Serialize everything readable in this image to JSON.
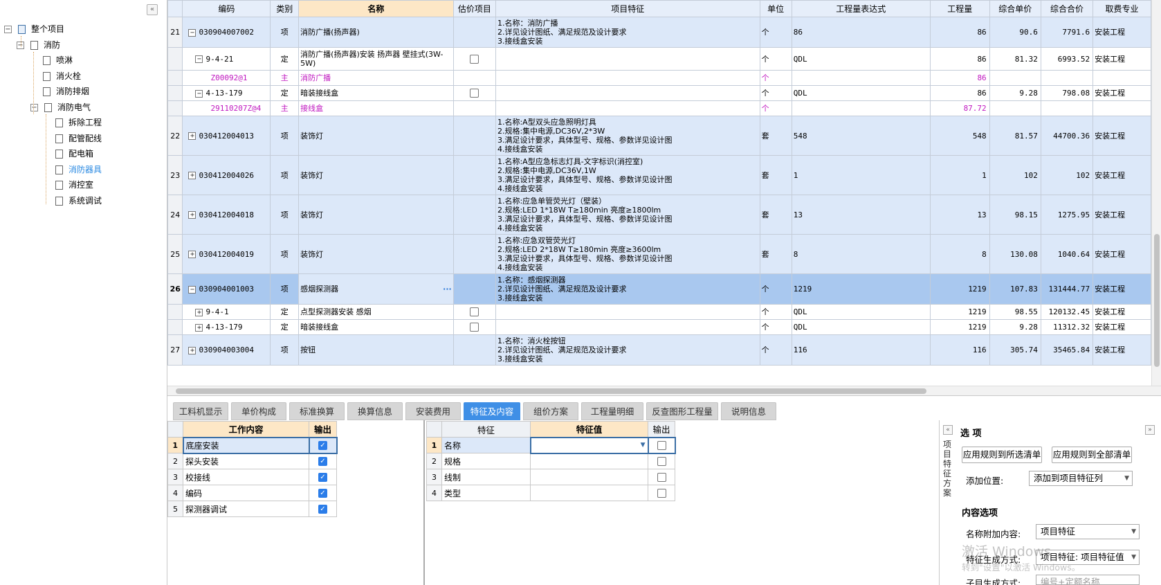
{
  "tree": {
    "collapse_icon": "«",
    "items": [
      {
        "label": "整个项目",
        "level": 0,
        "expander": "−",
        "root": true
      },
      {
        "label": "消防",
        "level": 1,
        "expander": "−"
      },
      {
        "label": "喷淋",
        "level": 2
      },
      {
        "label": "消火栓",
        "level": 2
      },
      {
        "label": "消防排烟",
        "level": 2
      },
      {
        "label": "消防电气",
        "level": 2,
        "expander": "−"
      },
      {
        "label": "拆除工程",
        "level": 3
      },
      {
        "label": "配管配线",
        "level": 3
      },
      {
        "label": "配电箱",
        "level": 3
      },
      {
        "label": "消防器具",
        "level": 3,
        "selected": true
      },
      {
        "label": "消控室",
        "level": 3
      },
      {
        "label": "系统调试",
        "level": 3
      }
    ]
  },
  "grid": {
    "headers": [
      "",
      "编码",
      "类别",
      "名称",
      "估价项目",
      "项目特征",
      "单位",
      "工程量表达式",
      "工程量",
      "综合单价",
      "综合合价",
      "取费专业"
    ],
    "rows": [
      {
        "type": "item",
        "no": "21",
        "exp": "−",
        "code": "030904007002",
        "cat": "项",
        "name": "消防广播(扬声器)",
        "est": "",
        "feat": "1.名称：消防广播\n2.详见设计图纸、满足规范及设计要求\n3.接线盒安装",
        "unit": "个",
        "expr": "86",
        "qty": "86",
        "price": "90.6",
        "total": "7791.6",
        "prof": "安装工程",
        "h": 44
      },
      {
        "type": "ding",
        "no": "",
        "exp": "−",
        "code": "9-4-21",
        "cat": "定",
        "name": "消防广播(扬声器)安装 扬声器 壁挂式(3W-5W)",
        "est": "cb",
        "feat": "",
        "unit": "个",
        "expr": "QDL",
        "qty": "86",
        "price": "81.32",
        "total": "6993.52",
        "prof": "安装工程",
        "h": 33
      },
      {
        "type": "zhu",
        "no": "",
        "exp": "",
        "code": "Z00092@1",
        "cat": "主",
        "name": "消防广播",
        "est": "",
        "feat": "",
        "unit": "个",
        "expr": "",
        "qty": "86",
        "price": "",
        "total": "",
        "prof": "",
        "h": 22
      },
      {
        "type": "ding",
        "no": "",
        "exp": "−",
        "code": "4-13-179",
        "cat": "定",
        "name": "暗装接线盒",
        "est": "cb",
        "feat": "",
        "unit": "个",
        "expr": "QDL",
        "qty": "86",
        "price": "9.28",
        "total": "798.08",
        "prof": "安装工程",
        "h": 22
      },
      {
        "type": "zhu",
        "no": "",
        "exp": "",
        "code": "29110207Z@4",
        "cat": "主",
        "name": "接线盒",
        "est": "",
        "feat": "",
        "unit": "个",
        "expr": "",
        "qty": "87.72",
        "price": "",
        "total": "",
        "prof": "",
        "h": 22
      },
      {
        "type": "item",
        "no": "22",
        "exp": "+",
        "code": "030412004013",
        "cat": "项",
        "name": "装饰灯",
        "est": "",
        "feat": "1.名称:A型双头应急照明灯具\n2.规格:集中电源,DC36V,2*3W\n3.满足设计要求，具体型号、规格、参数详见设计图\n4.接线盒安装",
        "unit": "套",
        "expr": "548",
        "qty": "548",
        "price": "81.57",
        "total": "44700.36",
        "prof": "安装工程",
        "h": 57
      },
      {
        "type": "item",
        "no": "23",
        "exp": "+",
        "code": "030412004026",
        "cat": "项",
        "name": "装饰灯",
        "est": "",
        "feat": "1.名称:A型应急标志灯具-文字标识(消控室)\n2.规格:集中电源,DC36V,1W\n3.满足设计要求，具体型号、规格、参数详见设计图\n4.接线盒安装",
        "unit": "套",
        "expr": "1",
        "qty": "1",
        "price": "102",
        "total": "102",
        "prof": "安装工程",
        "h": 57
      },
      {
        "type": "item",
        "no": "24",
        "exp": "+",
        "code": "030412004018",
        "cat": "项",
        "name": "装饰灯",
        "est": "",
        "feat": "1.名称:应急单管荧光灯（壁装）\n2.规格:LED 1*18W T≥180min 亮度≥1800lm\n3.满足设计要求，具体型号、规格、参数详见设计图\n4.接线盒安装",
        "unit": "套",
        "expr": "13",
        "qty": "13",
        "price": "98.15",
        "total": "1275.95",
        "prof": "安装工程",
        "h": 57
      },
      {
        "type": "item",
        "no": "25",
        "exp": "+",
        "code": "030412004019",
        "cat": "项",
        "name": "装饰灯",
        "est": "",
        "feat": "1.名称:应急双管荧光灯\n2.规格:LED 2*18W T≥180min 亮度≥3600lm\n3.满足设计要求，具体型号、规格、参数详见设计图\n4.接线盒安装",
        "unit": "套",
        "expr": "8",
        "qty": "8",
        "price": "130.08",
        "total": "1040.64",
        "prof": "安装工程",
        "h": 57
      },
      {
        "type": "sel",
        "no": "26",
        "exp": "−",
        "code": "030904001003",
        "cat": "项",
        "name": "感烟探测器",
        "est": "",
        "feat": "1.名称：感烟探测器\n2.详见设计图纸、满足规范及设计要求\n3.接线盒安装",
        "unit": "个",
        "expr": "1219",
        "qty": "1219",
        "price": "107.83",
        "total": "131444.77",
        "prof": "安装工程",
        "h": 44
      },
      {
        "type": "ding",
        "no": "",
        "exp": "+",
        "code": "9-4-1",
        "cat": "定",
        "name": "点型探测器安装 感烟",
        "est": "cb",
        "feat": "",
        "unit": "个",
        "expr": "QDL",
        "qty": "1219",
        "price": "98.55",
        "total": "120132.45",
        "prof": "安装工程",
        "h": 22
      },
      {
        "type": "ding",
        "no": "",
        "exp": "+",
        "code": "4-13-179",
        "cat": "定",
        "name": "暗装接线盒",
        "est": "cb",
        "feat": "",
        "unit": "个",
        "expr": "QDL",
        "qty": "1219",
        "price": "9.28",
        "total": "11312.32",
        "prof": "安装工程",
        "h": 22
      },
      {
        "type": "item",
        "no": "27",
        "exp": "+",
        "code": "030904003004",
        "cat": "项",
        "name": "按钮",
        "est": "",
        "feat": "1.名称：消火栓按钮\n2.详见设计图纸、满足规范及设计要求\n3.接线盒安装",
        "unit": "个",
        "expr": "116",
        "qty": "116",
        "price": "305.74",
        "total": "35465.84",
        "prof": "安装工程",
        "h": 44
      }
    ],
    "ellipsis": "···"
  },
  "tabs": [
    "工料机显示",
    "单价构成",
    "标准换算",
    "换算信息",
    "安装费用",
    "特征及内容",
    "组价方案",
    "工程量明细",
    "反查图形工程量",
    "说明信息"
  ],
  "active_tab": "特征及内容",
  "work_content": {
    "headers": [
      "",
      "工作内容",
      "输出"
    ],
    "rows": [
      {
        "no": "1",
        "label": "底座安装",
        "checked": true
      },
      {
        "no": "2",
        "label": "探头安装",
        "checked": true
      },
      {
        "no": "3",
        "label": "校接线",
        "checked": true
      },
      {
        "no": "4",
        "label": "编码",
        "checked": true
      },
      {
        "no": "5",
        "label": "探测器调试",
        "checked": true
      }
    ]
  },
  "features": {
    "headers": [
      "",
      "特征",
      "特征值",
      "输出"
    ],
    "rows": [
      {
        "no": "1",
        "label": "名称",
        "value": "",
        "checked": false
      },
      {
        "no": "2",
        "label": "规格",
        "value": "",
        "checked": false
      },
      {
        "no": "3",
        "label": "线制",
        "value": "",
        "checked": false
      },
      {
        "no": "4",
        "label": "类型",
        "value": "",
        "checked": false
      }
    ]
  },
  "options": {
    "vertical_label": "项目特征方案",
    "title": "选 项",
    "apply_selected": "应用规则到所选清单",
    "apply_all": "应用规则到全部清单",
    "add_pos_label": "添加位置:",
    "add_pos_value": "添加到项目特征列",
    "section": "内容选项",
    "name_append_label": "名称附加内容:",
    "name_append_value": "项目特征",
    "feat_gen_label": "特征生成方式:",
    "feat_gen_value": "项目特征: 项目特征值",
    "sub_gen_label": "子目生成方式:",
    "sub_gen_value": "编号+定额名称",
    "watermark_line1": "激活 Windows",
    "watermark_line2": "转到\"设置\"以激活 Windows。"
  }
}
